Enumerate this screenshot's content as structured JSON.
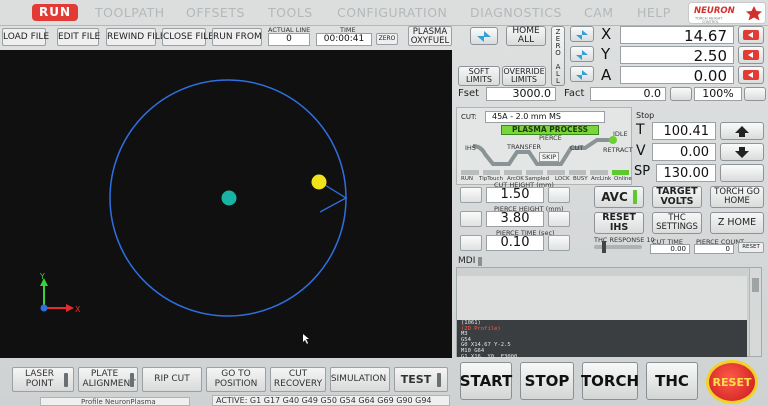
{
  "tabs": [
    "RUN",
    "TOOLPATH",
    "OFFSETS",
    "TOOLS",
    "CONFIGURATION",
    "DIAGNOSTICS",
    "CAM",
    "HELP"
  ],
  "logo": {
    "name": "NEURON",
    "tagline": "TORCH HEIGHT CONTROL"
  },
  "toolbar": {
    "load_file": "LOAD FILE",
    "edit_file": "EDIT FILE",
    "rewind_file": "REWIND FILE",
    "close_file": "CLOSE FILE",
    "run_from": "RUN FROM",
    "actual_line_label": "ACTUAL LINE",
    "actual_line": "0",
    "time_label": "TIME",
    "time": "00:00:41",
    "zero": "ZERO",
    "plasma": "PLASMA",
    "oxyfuel": "OXYFUEL"
  },
  "axes": {
    "home_all": "HOME ALL",
    "zero_all": "ZERO ALL",
    "soft_limits": "SOFT LIMITS",
    "override_limits": "OVERRIDE LIMITS",
    "x_label": "X",
    "x": "14.67",
    "y_label": "Y",
    "y": "2.50",
    "a_label": "A",
    "a": "0.00"
  },
  "feed": {
    "fset_label": "Fset",
    "fset": "3000.0",
    "fact_label": "Fact",
    "fact": "0.0",
    "override": "100%"
  },
  "thc": {
    "cut_label": "CUT:",
    "cut_profile": "45A - 2.0 mm MS",
    "state_label": "Stop",
    "process": "PLASMA PROCESS",
    "stages": [
      "IHS",
      "TRANSFER",
      "PIERCE",
      "SKIP",
      "CUT",
      "RETRACT",
      "IDLE"
    ],
    "status_flags": [
      "RUN",
      "TipTouch",
      "ArcOK",
      "Sampled",
      "LOCK",
      "BUSY",
      "ArcLink",
      "Online"
    ],
    "t_label": "T",
    "t": "100.41",
    "v_label": "V",
    "v": "0.00",
    "sp_label": "SP",
    "sp": "130.00",
    "cut_height_label": "CUT HEIGHT (mm)",
    "cut_height": "1.50",
    "pierce_height_label": "PIERCE HEIGHT (mm)",
    "pierce_height": "3.80",
    "pierce_time_label": "PIERCE TIME (sec)",
    "pierce_time": "0.10",
    "avc": "AVC",
    "target_volts": "TARGET VOLTS",
    "torch_go_home": "TORCH GO HOME",
    "reset_ihs": "RESET IHS",
    "thc_settings": "THC SETTINGS",
    "z_home": "Z HOME",
    "thc_response_label": "THC RESPONSE 10",
    "cut_time_label": "CUT TIME",
    "cut_time": "0.00",
    "pierce_count_label": "PIERCE COUNT",
    "pierce_count": "0",
    "reset_small": "RESET"
  },
  "mdi": {
    "label": "MDI",
    "lines": [
      "(1061)",
      "(2D Profile)",
      "M3",
      "G54",
      "G0 X14.67 Y-2.5",
      "M10 G64",
      "G1 X16. Y0. F3000"
    ]
  },
  "bottom": {
    "laser_point": "LASER POINT",
    "plate_alignment": "PLATE ALIGNMENT",
    "rip_cut": "RIP CUT",
    "go_to_position": "GO TO POSITION",
    "cut_recovery": "CUT RECOVERY",
    "simulation": "SIMULATION",
    "test": "TEST",
    "profile": "Profile NeuronPlasma",
    "active_codes": "ACTIVE: G1 G17 G40 G49 G50 G54 G64 G69 G90 G94"
  },
  "actions": {
    "start": "START",
    "stop": "STOP",
    "torch": "TORCH",
    "thc": "THC",
    "reset": "RESET"
  },
  "colors": {
    "accent_red": "#e23a34",
    "led_green": "#5ec92e",
    "circle": "#2f6fe0",
    "dot_start": "#18b3a3",
    "dot_current": "#f2e21a",
    "axis_y": "#3bd13b",
    "axis_x": "#e52b2b"
  }
}
